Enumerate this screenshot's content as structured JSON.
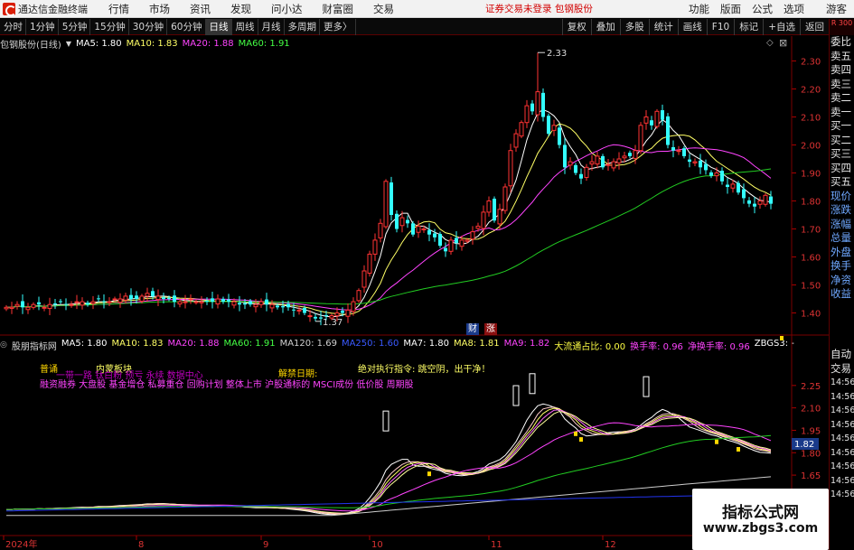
{
  "menubar": {
    "title": "通达信金融终端",
    "items": [
      "行情",
      "市场",
      "资讯",
      "发现",
      "问小达",
      "财富圈",
      "交易"
    ],
    "login_status": "证券交易未登录  包钢股份",
    "right_items": [
      "功能",
      "版面",
      "公式",
      "选项"
    ],
    "guest": "游客"
  },
  "toolbar": {
    "periods": [
      "分时",
      "1分钟",
      "5分钟",
      "15分钟",
      "30分钟",
      "60分钟",
      "日线",
      "周线",
      "月线",
      "多周期",
      "更多〉"
    ],
    "active_period": "日线",
    "right_tools": [
      "复权",
      "叠加",
      "多股",
      "统计",
      "画线",
      "F10",
      "标记",
      "+自选",
      "返回"
    ]
  },
  "side_panel": {
    "head": "R 300",
    "items": [
      "委比",
      "卖五",
      "卖四",
      "卖三",
      "卖二",
      "卖一",
      "买一",
      "买二",
      "买三",
      "买四",
      "买五",
      "现价",
      "涨跌",
      "涨幅",
      "总量",
      "外盘",
      "换手",
      "净资",
      "收益"
    ],
    "lower_items": [
      "自动",
      "交易",
      "14:56",
      "14:56",
      "14:56",
      "14:56",
      "14:56",
      "14:56",
      "14:56",
      "14:56",
      "14:56"
    ]
  },
  "main_pane": {
    "stock": "包钢股份(日线)",
    "ma": [
      {
        "label": "MA5: 1.80",
        "color": "#ffffff"
      },
      {
        "label": "MA10: 1.83",
        "color": "#ffff66"
      },
      {
        "label": "MA20: 1.88",
        "color": "#ff44ff"
      },
      {
        "label": "MA60: 1.91",
        "color": "#44ff44"
      }
    ],
    "high_label": "2.33",
    "low_label": "1.37",
    "y_ticks": [
      "2.30",
      "2.20",
      "2.10",
      "2.00",
      "1.90",
      "1.80",
      "1.70",
      "1.60",
      "1.50",
      "1.40"
    ],
    "badges": {
      "cai": "财",
      "zhang": "涨"
    }
  },
  "indicator_pane": {
    "name": "股朋指标网",
    "values": [
      {
        "label": "MA5: 1.80",
        "color": "#ffffff"
      },
      {
        "label": "MA10: 1.83",
        "color": "#ffff66"
      },
      {
        "label": "MA20: 1.88",
        "color": "#ff44ff"
      },
      {
        "label": "MA60: 1.91",
        "color": "#44ff44"
      },
      {
        "label": "MA120: 1.69",
        "color": "#d0d0d0"
      },
      {
        "label": "MA250: 1.60",
        "color": "#3a5aff"
      },
      {
        "label": "MA7: 1.80",
        "color": "#ffffff"
      },
      {
        "label": "MA8: 1.81",
        "color": "#ffff66"
      },
      {
        "label": "MA9: 1.82",
        "color": "#ff44ff"
      },
      {
        "label": "大流通占比: 0.00",
        "color": "#ffff44"
      },
      {
        "label": "换手率: 0.96",
        "color": "#ff44ff"
      },
      {
        "label": "净换手率: 0.96",
        "color": "#ff44ff"
      },
      {
        "label": "ZBGS3: -",
        "color": "#ffffff"
      }
    ],
    "texts": {
      "t1": "普诵",
      "t2": "内蒙板块",
      "t3": "一带一路 钛白粉 预亏 永续 数据中心",
      "t4": "解禁日期:",
      "t5": "绝对执行指令:    跳空阴，出干净！",
      "t6": "融资融券 大盘股 基金增仓 私募重仓 回购计划 整体上市 沪股通标的 MSCI成份 低价股 周期股"
    },
    "y_ticks": [
      "2.25",
      "2.10",
      "1.95",
      "1.80",
      "1.65"
    ],
    "price_tag": "1.82"
  },
  "x_axis": {
    "labels": [
      "2024年",
      "8",
      "9",
      "10",
      "11",
      "12"
    ]
  },
  "watermark": {
    "title": "指标公式网",
    "url": "www.zbgs3.com"
  },
  "chart_data": {
    "type": "candlestick",
    "title": "包钢股份(日线)",
    "ylim": [
      1.35,
      2.35
    ],
    "up_color": "#ff3333",
    "down_color": "#33ffff",
    "high": 2.33,
    "low": 1.37,
    "months": [
      "2024年",
      "8",
      "9",
      "10",
      "11",
      "12"
    ],
    "closes": [
      1.42,
      1.42,
      1.43,
      1.42,
      1.42,
      1.43,
      1.43,
      1.42,
      1.43,
      1.43,
      1.44,
      1.43,
      1.43,
      1.44,
      1.44,
      1.43,
      1.44,
      1.45,
      1.44,
      1.44,
      1.45,
      1.45,
      1.46,
      1.45,
      1.45,
      1.46,
      1.47,
      1.46,
      1.46,
      1.45,
      1.45,
      1.44,
      1.44,
      1.44,
      1.45,
      1.44,
      1.44,
      1.44,
      1.44,
      1.45,
      1.44,
      1.44,
      1.44,
      1.43,
      1.43,
      1.43,
      1.43,
      1.44,
      1.43,
      1.43,
      1.42,
      1.42,
      1.42,
      1.41,
      1.41,
      1.4,
      1.39,
      1.38,
      1.38,
      1.39,
      1.39,
      1.4,
      1.4,
      1.41,
      1.44,
      1.48,
      1.55,
      1.61,
      1.66,
      1.72,
      1.87,
      1.75,
      1.7,
      1.74,
      1.72,
      1.68,
      1.71,
      1.7,
      1.68,
      1.67,
      1.64,
      1.62,
      1.66,
      1.65,
      1.66,
      1.66,
      1.69,
      1.71,
      1.76,
      1.8,
      1.73,
      1.77,
      1.85,
      1.98,
      2.04,
      2.08,
      2.14,
      2.12,
      2.19,
      2.1,
      2.04,
      2.07,
      2.0,
      1.92,
      1.94,
      1.9,
      1.88,
      1.92,
      1.94,
      1.96,
      1.92,
      1.93,
      1.94,
      1.95,
      1.96,
      1.96,
      1.98,
      2.07,
      2.1,
      2.07,
      2.12,
      2.09,
      2.0,
      1.98,
      1.98,
      1.96,
      1.94,
      1.94,
      1.92,
      1.91,
      1.89,
      1.9,
      1.87,
      1.85,
      1.86,
      1.83,
      1.81,
      1.79,
      1.78,
      1.8,
      1.82,
      1.79
    ]
  }
}
